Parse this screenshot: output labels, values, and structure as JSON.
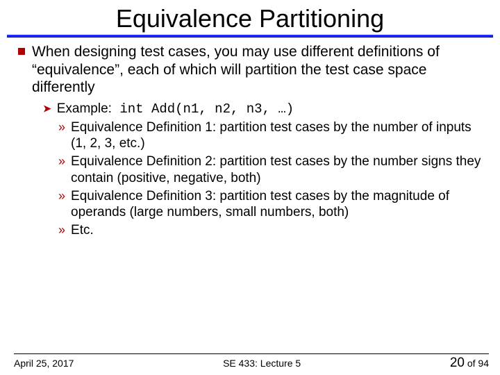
{
  "title": "Equivalence Partitioning",
  "bullet1": "When designing test cases, you may use different definitions of “equivalence”, each of which will partition the test case space differently",
  "example_label": "Example:",
  "example_code": " int Add(n1, n2, n3, …)",
  "defs": [
    "Equivalence Definition 1: partition test cases by the number of inputs (1, 2, 3, etc.)",
    "Equivalence Definition 2: partition test cases by the number signs they contain (positive, negative, both)",
    "Equivalence Definition 3: partition test cases by the magnitude of operands (large numbers, small numbers, both)",
    "Etc."
  ],
  "footer": {
    "date": "April 25, 2017",
    "course": "SE 433: Lecture 5",
    "page_current": "20",
    "page_of": " of 94"
  }
}
